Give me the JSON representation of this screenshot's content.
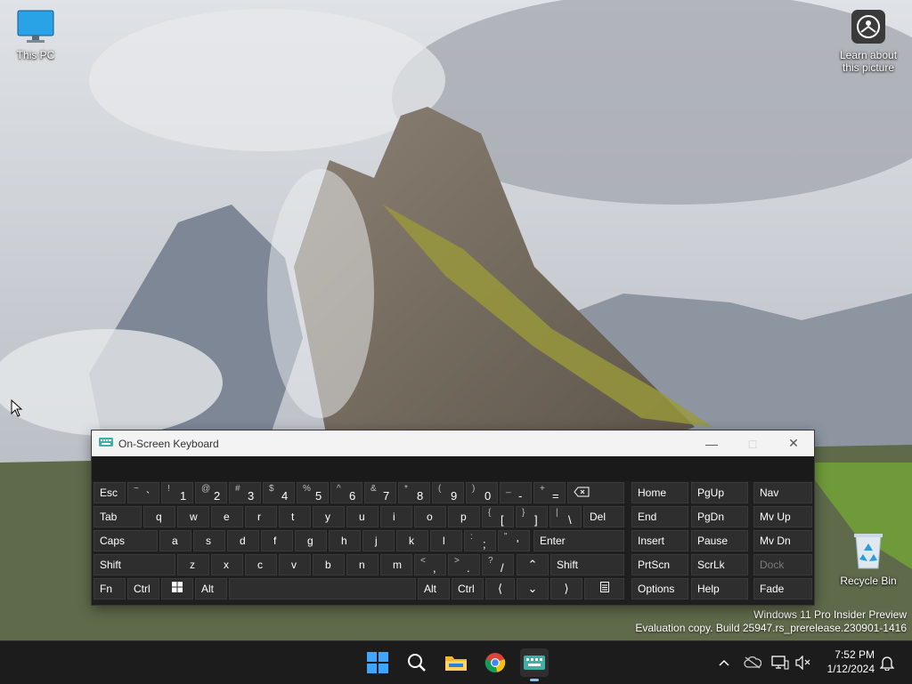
{
  "desktop": {
    "this_pc": "This PC",
    "learn_picture": "Learn about\nthis picture",
    "recycle_bin": "Recycle Bin"
  },
  "watermark": {
    "line1": "Windows 11 Pro Insider Preview",
    "line2": "Evaluation copy. Build 25947.rs_prerelease.230901-1416"
  },
  "osk": {
    "title": "On-Screen Keyboard",
    "keys": {
      "esc": "Esc",
      "tab": "Tab",
      "caps": "Caps",
      "shift": "Shift",
      "fn": "Fn",
      "ctrl": "Ctrl",
      "alt": "Alt",
      "del": "Del",
      "enter": "Enter",
      "rshift": "Shift",
      "ralt": "Alt",
      "rctrl": "Ctrl",
      "home": "Home",
      "pgup": "PgUp",
      "nav": "Nav",
      "end": "End",
      "pgdn": "PgDn",
      "mvup": "Mv Up",
      "insert": "Insert",
      "pause": "Pause",
      "mvdn": "Mv Dn",
      "prtscn": "PrtScn",
      "scrlk": "ScrLk",
      "dock": "Dock",
      "options": "Options",
      "help": "Help",
      "fade": "Fade",
      "row1": [
        {
          "s": "~",
          "p": "`"
        },
        {
          "s": "!",
          "p": "1"
        },
        {
          "s": "@",
          "p": "2"
        },
        {
          "s": "#",
          "p": "3"
        },
        {
          "s": "$",
          "p": "4"
        },
        {
          "s": "%",
          "p": "5"
        },
        {
          "s": "^",
          "p": "6"
        },
        {
          "s": "&",
          "p": "7"
        },
        {
          "s": "*",
          "p": "8"
        },
        {
          "s": "(",
          "p": "9"
        },
        {
          "s": ")",
          "p": "0"
        },
        {
          "s": "_",
          "p": "-"
        },
        {
          "s": "+",
          "p": "="
        }
      ],
      "row2": [
        "q",
        "w",
        "e",
        "r",
        "t",
        "y",
        "u",
        "i",
        "o",
        "p",
        {
          "s": "{",
          "p": "["
        },
        {
          "s": "}",
          "p": "]"
        },
        {
          "s": "|",
          "p": "\\"
        }
      ],
      "row3": [
        "a",
        "s",
        "d",
        "f",
        "g",
        "h",
        "j",
        "k",
        "l",
        {
          "s": ":",
          "p": ";"
        },
        {
          "s": "\"",
          "p": "'"
        }
      ],
      "row4": [
        "z",
        "x",
        "c",
        "v",
        "b",
        "n",
        "m",
        {
          "s": "<",
          "p": ","
        },
        {
          "s": ">",
          "p": "."
        },
        {
          "s": "?",
          "p": "/"
        }
      ]
    }
  },
  "taskbar": {
    "time": "7:52 PM",
    "date": "1/12/2024"
  },
  "colors": {
    "taskbar_bg": "#1c1c1c",
    "osk_bg": "#1f1f1f",
    "key_bg": "#2e2e2e",
    "accent": "#0078d4"
  }
}
